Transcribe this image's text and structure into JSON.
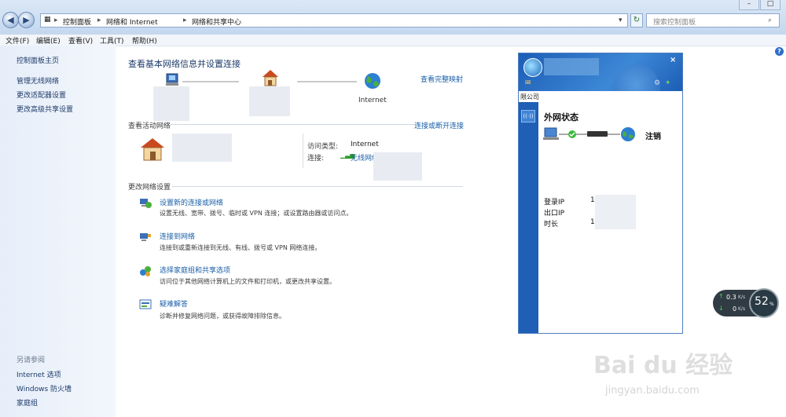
{
  "address": {
    "crumbs": [
      "控制面板",
      "网络和 Internet",
      "网络和共享中心"
    ],
    "search_placeholder": "搜索控制面板"
  },
  "menu": [
    "文件(F)",
    "编辑(E)",
    "查看(V)",
    "工具(T)",
    "帮助(H)"
  ],
  "sidebar": {
    "home": "控制面板主页",
    "links": [
      "管理无线网络",
      "更改适配器设置",
      "更改高级共享设置"
    ],
    "see_also_title": "另请参阅",
    "see_also": [
      "Internet 选项",
      "Windows 防火墙",
      "家庭组"
    ]
  },
  "main": {
    "title": "查看基本网络信息并设置连接",
    "view_full_map": "查看完整映射",
    "internet_label": "Internet",
    "active_section": "查看活动网络",
    "connect_disconnect": "连接或断开连接",
    "access_type_label": "访问类型:",
    "access_type_value": "Internet",
    "connection_label": "连接:",
    "connection_value": "无线网络连接",
    "change_section": "更改网络设置",
    "tasks": [
      {
        "title": "设置新的连接或网络",
        "desc": "设置无线、宽带、拨号、临时或 VPN 连接；或设置路由器或访问点。"
      },
      {
        "title": "连接到网络",
        "desc": "连接到或重新连接到无线、有线、拨号或 VPN 网络连接。"
      },
      {
        "title": "选择家庭组和共享选项",
        "desc": "访问位于其他网络计算机上的文件和打印机，或更改共享设置。"
      },
      {
        "title": "疑难解答",
        "desc": "诊断并修复网络问题，或获得故障排除信息。"
      }
    ]
  },
  "popup": {
    "tab_text": "限公司",
    "status_title": "外网状态",
    "logout": "注销",
    "rows": [
      {
        "label": "登录IP",
        "value": "10."
      },
      {
        "label": "出口IP",
        "value": ""
      },
      {
        "label": "时长",
        "value": "1"
      }
    ]
  },
  "speed": {
    "up": "0.3",
    "down": "0",
    "unit": "K/s",
    "percent": "52",
    "percent_sign": "%"
  },
  "watermark": {
    "logo": "Bai du 经验",
    "url": "jingyan.baidu.com"
  }
}
